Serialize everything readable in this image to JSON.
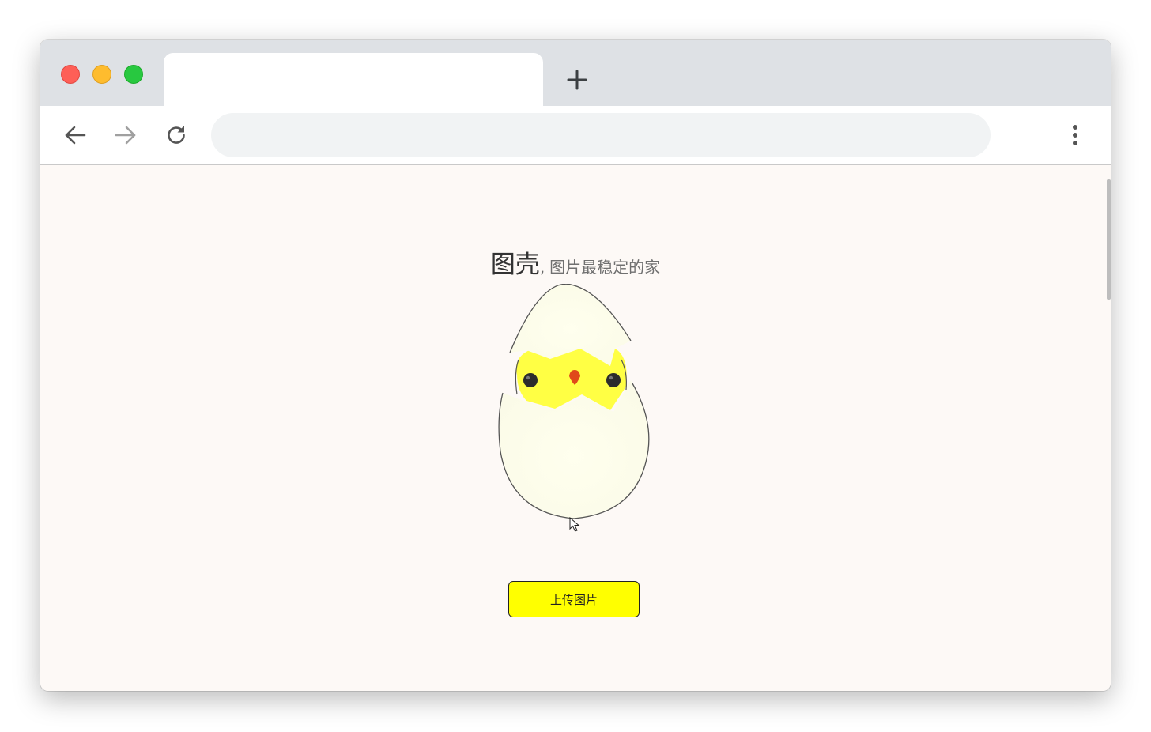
{
  "window": {
    "traffic_lights": {
      "close_color": "#fe5f57",
      "minimize_color": "#febc2e",
      "maximize_color": "#28c840"
    },
    "tab": {
      "title": ""
    },
    "new_tab_icon": "plus-icon"
  },
  "toolbar": {
    "back_icon": "arrow-left-icon",
    "forward_icon": "arrow-right-icon",
    "reload_icon": "reload-icon",
    "address": {
      "value": "",
      "placeholder": ""
    },
    "menu_icon": "more-vertical-icon"
  },
  "page": {
    "brand": "图壳",
    "separator": ",",
    "tagline": "图片最稳定的家",
    "mascot": "egg-chick-illustration",
    "upload_button": "上传图片",
    "colors": {
      "background": "#fdf9f6",
      "accent": "#ffff00",
      "chick": "#ffff44",
      "beak": "#e04a1a"
    }
  }
}
